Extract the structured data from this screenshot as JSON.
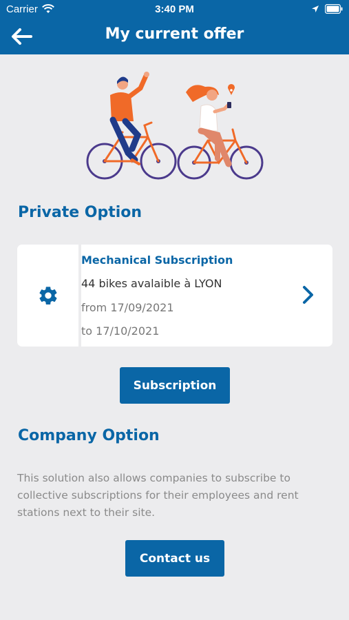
{
  "status_bar": {
    "carrier": "Carrier",
    "time": "3:40 PM"
  },
  "header": {
    "title": "My current offer",
    "back_icon": "arrow-left-icon"
  },
  "private_section": {
    "title": "Private Option",
    "card": {
      "icon": "gear-icon",
      "title": "Mechanical Subscription",
      "availability": "44 bikes avalaible à LYON",
      "from": "from 17/09/2021",
      "to": "to 17/10/2021"
    },
    "button_label": "Subscription"
  },
  "company_section": {
    "title": "Company Option",
    "description": "This solution also allows companies to subscribe to collective subscriptions for their employees and rent stations next to their site.",
    "button_label": "Contact us"
  },
  "colors": {
    "primary": "#0a66a6",
    "background": "#ececee",
    "accent_orange": "#f06a28",
    "accent_purple": "#4b3a8c"
  }
}
